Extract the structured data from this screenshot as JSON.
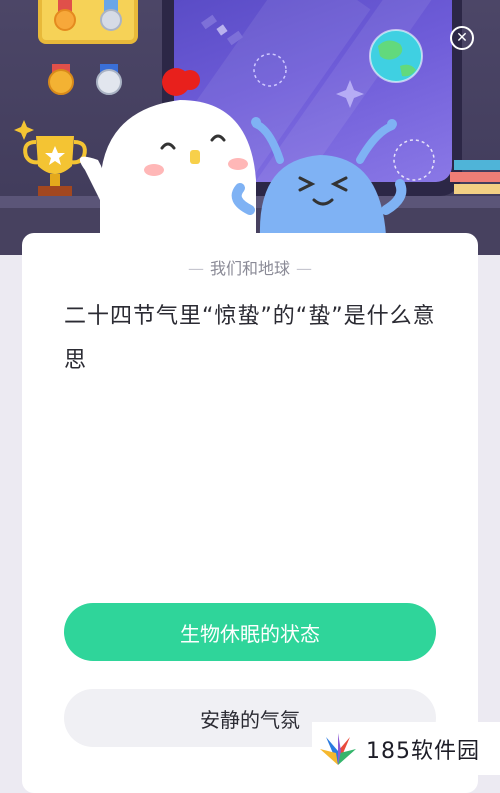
{
  "header": {
    "close_icon": "close-icon"
  },
  "card": {
    "category": "我们和地球",
    "question": "二十四节气里“惊蛰”的“蛰”是什么意思",
    "options": [
      {
        "label": "生物休眠的状态",
        "highlighted": true
      },
      {
        "label": "安静的气氛",
        "highlighted": false
      }
    ]
  },
  "watermark": {
    "text": "185软件园"
  },
  "colors": {
    "accent_green": "#2fd59a",
    "hero_background": "#4c4667",
    "card_background": "#ffffff"
  }
}
